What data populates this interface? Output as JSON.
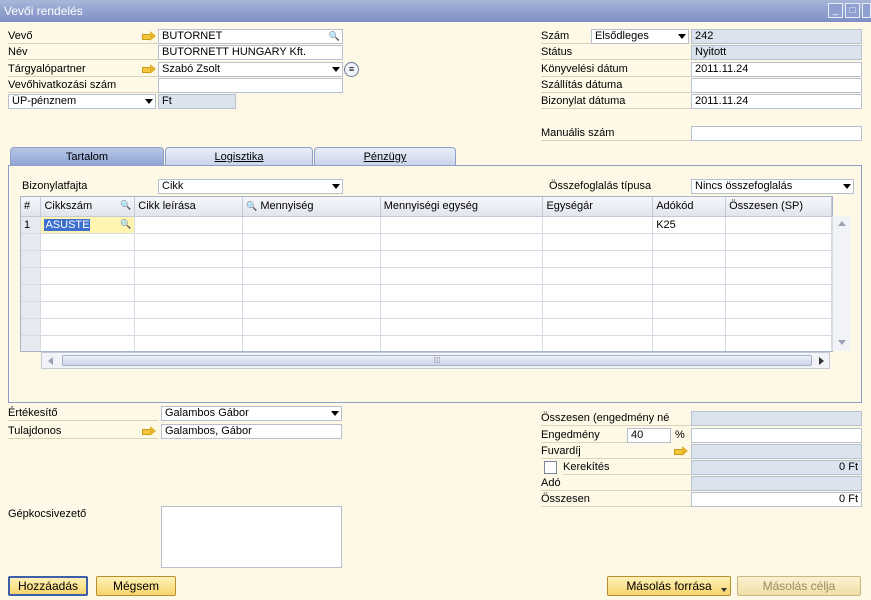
{
  "window": {
    "title": "Vevői rendelés"
  },
  "header_left": {
    "vevo": {
      "label": "Vevő",
      "value": "BUTORNET"
    },
    "nev": {
      "label": "Név",
      "value": "BÚTORNETT HUNGARY Kft."
    },
    "targyalopartner": {
      "label": "Tárgyalópartner",
      "value": "Szabó Zsolt"
    },
    "vevohivatkozasi": {
      "label": "Vevőhivatkozási szám",
      "value": ""
    },
    "penznem": {
      "label": "ÜP-pénznem",
      "value": "Ft"
    }
  },
  "header_right": {
    "szam": {
      "label": "Szám",
      "series": "Elsődleges",
      "value": "242"
    },
    "statusz": {
      "label": "Státus",
      "value": "Nyitott"
    },
    "konyvelesi": {
      "label": "Könyvelési dátum",
      "value": "2011.11.24"
    },
    "szallitas": {
      "label": "Szállítás dátuma",
      "value": ""
    },
    "bizonylat": {
      "label": "Bizonylat dátuma",
      "value": "2011.11.24"
    },
    "manualis": {
      "label": "Manuális szám",
      "value": ""
    }
  },
  "tabs": [
    {
      "label": "Tartalom"
    },
    {
      "label": "Logisztika"
    },
    {
      "label": "Pénzügy"
    }
  ],
  "content": {
    "bizonylatfajta": {
      "label": "Bizonylatfajta",
      "value": "Cikk"
    },
    "osszefoglalas": {
      "label": "Összefoglalás típusa",
      "value": "Nincs összefoglalás"
    }
  },
  "grid": {
    "columns": [
      "#",
      "Cikkszám",
      "Cikk leírása",
      "Mennyiség",
      "Mennyiségi egység",
      "Egységár",
      "Adókód",
      "Összesen (SP)"
    ],
    "rows": [
      [
        "1",
        "ASUSTE",
        "",
        "",
        "",
        "",
        "K25",
        ""
      ]
    ]
  },
  "footer_left": {
    "ertekesito": {
      "label": "Értékesítő",
      "value": "Galambos Gábor"
    },
    "tulajdonos": {
      "label": "Tulajdonos",
      "value": "Galambos, Gábor"
    },
    "gepkocsivezeto": {
      "label": "Gépkocsivezető"
    }
  },
  "footer_right": {
    "osszesen_eng": {
      "label": "Összesen (engedmény né",
      "value": ""
    },
    "engedmeny": {
      "label": "Engedmény",
      "percent": "40",
      "percent_sign": "%",
      "value": ""
    },
    "fuvardij": {
      "label": "Fuvardíj",
      "value": ""
    },
    "kerekites": {
      "label": "Kerekítés",
      "value": "0 Ft"
    },
    "ado": {
      "label": "Adó",
      "value": ""
    },
    "osszesen": {
      "label": "Összesen",
      "value": "0 Ft"
    }
  },
  "buttons": {
    "hozzaadas": "Hozzáadás",
    "megsem": "Mégsem",
    "masolas_forrasa": "Másolás forrása",
    "masolas_celja": "Másolás célja"
  },
  "icons": [
    "link-arrow-icon",
    "search-icon",
    "dropdown-arrow-icon",
    "context-icon",
    "minimize-icon",
    "maximize-icon",
    "close-icon"
  ],
  "colors": {
    "title_bar": "#8b9bd0",
    "background": "#fdf9e6",
    "readonly_field": "#dbe3ef",
    "button": "#f6d46c",
    "selection": "#3d6fd1"
  }
}
